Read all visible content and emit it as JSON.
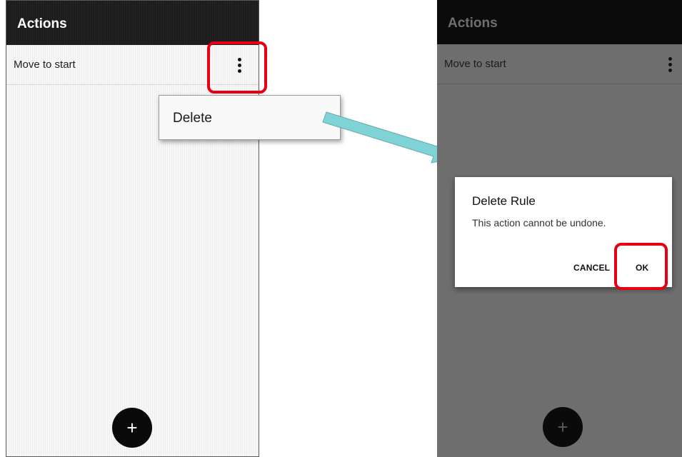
{
  "left_screen": {
    "appbar": {
      "title": "Actions"
    },
    "list": [
      {
        "label": "Move to start",
        "menu_icon": "more-vert-icon"
      }
    ],
    "popup_menu": {
      "items": [
        {
          "label": "Delete"
        }
      ]
    },
    "fab": {
      "label": "+",
      "icon": "add-icon"
    }
  },
  "right_screen": {
    "appbar": {
      "title": "Actions"
    },
    "list": [
      {
        "label": "Move to start",
        "menu_icon": "more-vert-icon"
      }
    ],
    "fab": {
      "label": "+",
      "icon": "add-icon"
    },
    "dialog": {
      "title": "Delete Rule",
      "message": "This action cannot be undone.",
      "cancel_label": "CANCEL",
      "ok_label": "OK"
    }
  },
  "colors": {
    "highlight": "#e60012",
    "arrow": "#7fd3d6",
    "appbar": "#1c1c1c",
    "dimmed_background": "#6e6e6e"
  }
}
